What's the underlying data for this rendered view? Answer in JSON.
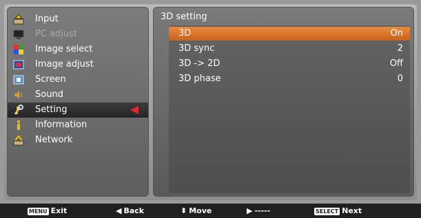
{
  "menu": {
    "items": [
      {
        "label": "Input",
        "icon": "input-icon",
        "state": "normal"
      },
      {
        "label": "PC adjust",
        "icon": "pc-adjust-icon",
        "state": "disabled"
      },
      {
        "label": "Image select",
        "icon": "image-select-icon",
        "state": "normal"
      },
      {
        "label": "Image adjust",
        "icon": "image-adjust-icon",
        "state": "normal"
      },
      {
        "label": "Screen",
        "icon": "screen-icon",
        "state": "normal"
      },
      {
        "label": "Sound",
        "icon": "sound-icon",
        "state": "normal"
      },
      {
        "label": "Setting",
        "icon": "setting-icon",
        "state": "selected"
      },
      {
        "label": "Information",
        "icon": "information-icon",
        "state": "normal"
      },
      {
        "label": "Network",
        "icon": "network-icon",
        "state": "normal"
      }
    ]
  },
  "panel": {
    "title": "3D setting",
    "rows": [
      {
        "name": "3D",
        "value": "On"
      },
      {
        "name": "3D sync",
        "value": "2"
      },
      {
        "name": "3D -> 2D",
        "value": "Off"
      },
      {
        "name": "3D phase",
        "value": "0"
      }
    ]
  },
  "footer": {
    "exit_key": "MENU",
    "exit_label": "Exit",
    "back_label": "Back",
    "move_label": "Move",
    "next_dash": "-----",
    "next_key": "SELECT",
    "next_label": "Next"
  },
  "colors": {
    "highlight": "#e08035",
    "pointer": "#e8262a",
    "footer": "#1f1f1f"
  }
}
